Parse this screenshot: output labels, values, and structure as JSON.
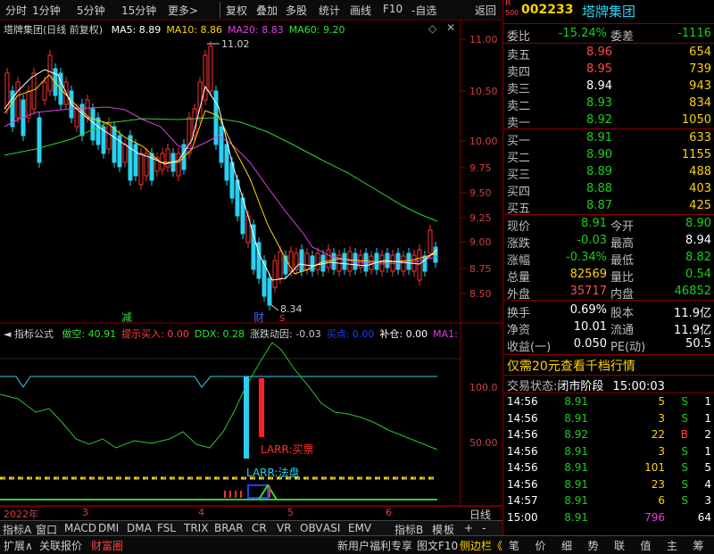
{
  "toolbar": {
    "left": [
      "分时",
      "1分钟",
      "5分钟",
      "15分钟",
      "更多>"
    ],
    "right": [
      "复权",
      "叠加",
      "多股",
      "统计",
      "画线",
      "F10",
      "-自选",
      "返回"
    ]
  },
  "chart": {
    "title": "塔牌集团(日线 前复权)",
    "ma": [
      {
        "label": "MA5: 8.89",
        "color": "#ffffff"
      },
      {
        "label": "MA10: 8.86",
        "color": "#ffd700"
      },
      {
        "label": "MA20: 8.83",
        "color": "#e040e0"
      },
      {
        "label": "MA60: 9.20",
        "color": "#30e030"
      }
    ],
    "price_ticks": [
      "11.00",
      "10.50",
      "10.00",
      "9.75",
      "9.50",
      "9.25",
      "9.00",
      "8.75",
      "8.50"
    ],
    "high_label": "11.02",
    "low_label": "8.34",
    "markers": {
      "jian": "减",
      "cai": "财",
      "s": "S"
    }
  },
  "indicator": {
    "name": "指标公式",
    "items": [
      {
        "label": "做空: 40.91",
        "color": "#30e030"
      },
      {
        "label": "提示买入: 0.00",
        "color": "#ff4040"
      },
      {
        "label": "DDX: 0.28",
        "color": "#30e030"
      },
      {
        "label": "涨跌动因: -0.03",
        "color": "#cfcfcf"
      },
      {
        "label": "买点: 0.00",
        "color": "#2040ff"
      },
      {
        "label": "补仓: 0.00",
        "color": "#ffffff"
      },
      {
        "label": "MA1:",
        "color": "#e040e0"
      }
    ],
    "ticks": [
      "100.0",
      "50.00"
    ],
    "buy_label": "LARR:买票",
    "sell_label": "LARR:法盘"
  },
  "dates": {
    "year": "2022年",
    "m3": "3",
    "m4": "4",
    "m5": "5",
    "m6": "6",
    "period": "日线"
  },
  "tabs": [
    "指标A",
    "窗口",
    "MACD",
    "DMI",
    "DMA",
    "FSL",
    "TRIX",
    "BRAR",
    "CR",
    "VR",
    "OBV",
    "ASI",
    "EMV",
    "指标B",
    "模",
    "板",
    "+",
    "-"
  ],
  "footer": {
    "left": [
      "扩展∧",
      "关联报价",
      "财富圈"
    ],
    "mid": [
      "新用户福利专享",
      "图文F10",
      "侧边栏《"
    ],
    "right": [
      "笔",
      "价",
      "细",
      "势",
      "联",
      "值",
      "主",
      "筹"
    ]
  },
  "quote": {
    "r_badge": "R",
    "num_badge": "500",
    "code": "002233",
    "name": "塔牌集团",
    "weibi_label": "委比",
    "weibi": "-15.24%",
    "weicha_label": "委差",
    "weicha": "-1116",
    "sells": [
      {
        "label": "卖五",
        "price": "8.96",
        "vol": "654",
        "pcolor": "red"
      },
      {
        "label": "卖四",
        "price": "8.95",
        "vol": "739",
        "pcolor": "red"
      },
      {
        "label": "卖三",
        "price": "8.94",
        "vol": "943",
        "pcolor": "wht"
      },
      {
        "label": "卖二",
        "price": "8.93",
        "vol": "834",
        "pcolor": "grn"
      },
      {
        "label": "卖一",
        "price": "8.92",
        "vol": "1050",
        "pcolor": "grn"
      }
    ],
    "buys": [
      {
        "label": "买一",
        "price": "8.91",
        "vol": "633",
        "pcolor": "grn"
      },
      {
        "label": "买二",
        "price": "8.90",
        "vol": "1155",
        "pcolor": "grn"
      },
      {
        "label": "买三",
        "price": "8.89",
        "vol": "488",
        "pcolor": "grn"
      },
      {
        "label": "买四",
        "price": "8.88",
        "vol": "403",
        "pcolor": "grn"
      },
      {
        "label": "买五",
        "price": "8.87",
        "vol": "425",
        "pcolor": "grn"
      }
    ],
    "stats": [
      {
        "l1": "现价",
        "v1": "8.91",
        "c1": "grn",
        "l2": "今开",
        "v2": "8.90",
        "c2": "grn"
      },
      {
        "l1": "涨跌",
        "v1": "-0.03",
        "c1": "grn",
        "l2": "最高",
        "v2": "8.94",
        "c2": "wht"
      },
      {
        "l1": "涨幅",
        "v1": "-0.34%",
        "c1": "grn",
        "l2": "最低",
        "v2": "8.82",
        "c2": "grn"
      },
      {
        "l1": "总量",
        "v1": "82569",
        "c1": "yel",
        "l2": "量比",
        "v2": "0.54",
        "c2": "grn"
      },
      {
        "l1": "外盘",
        "v1": "35717",
        "c1": "red",
        "l2": "内盘",
        "v2": "46852",
        "c2": "grn"
      }
    ],
    "stats2": [
      {
        "l1": "换手",
        "v1": "0.69%",
        "l2": "股本",
        "v2": "11.9亿"
      },
      {
        "l1": "净资",
        "v1": "10.01",
        "l2": "流通",
        "v2": "11.9亿"
      },
      {
        "l1": "收益(一)",
        "v1": "0.050",
        "l2": "PE(动)",
        "v2": "50.5"
      }
    ],
    "promo": "仅需20元查看千档行情",
    "status_label": "交易状态:",
    "status": "闭市阶段",
    "status_time": "15:00:03",
    "ticks": [
      {
        "t": "14:56",
        "p": "8.91",
        "v": "5",
        "s": "S",
        "n": "1",
        "vc": "yel",
        "sc": "grn"
      },
      {
        "t": "14:56",
        "p": "8.91",
        "v": "3",
        "s": "S",
        "n": "1",
        "vc": "yel",
        "sc": "grn"
      },
      {
        "t": "14:56",
        "p": "8.92",
        "v": "22",
        "s": "B",
        "n": "2",
        "vc": "yel",
        "sc": "red"
      },
      {
        "t": "14:56",
        "p": "8.91",
        "v": "3",
        "s": "S",
        "n": "1",
        "vc": "yel",
        "sc": "grn"
      },
      {
        "t": "14:56",
        "p": "8.91",
        "v": "101",
        "s": "S",
        "n": "5",
        "vc": "yel",
        "sc": "grn"
      },
      {
        "t": "14:56",
        "p": "8.91",
        "v": "23",
        "s": "S",
        "n": "4",
        "vc": "yel",
        "sc": "grn"
      },
      {
        "t": "14:57",
        "p": "8.91",
        "v": "6",
        "s": "S",
        "n": "3",
        "vc": "yel",
        "sc": "grn"
      },
      {
        "t": "15:00",
        "p": "8.91",
        "v": "796",
        "s": "",
        "n": "64",
        "vc": "mag",
        "sc": "grn"
      }
    ]
  }
}
